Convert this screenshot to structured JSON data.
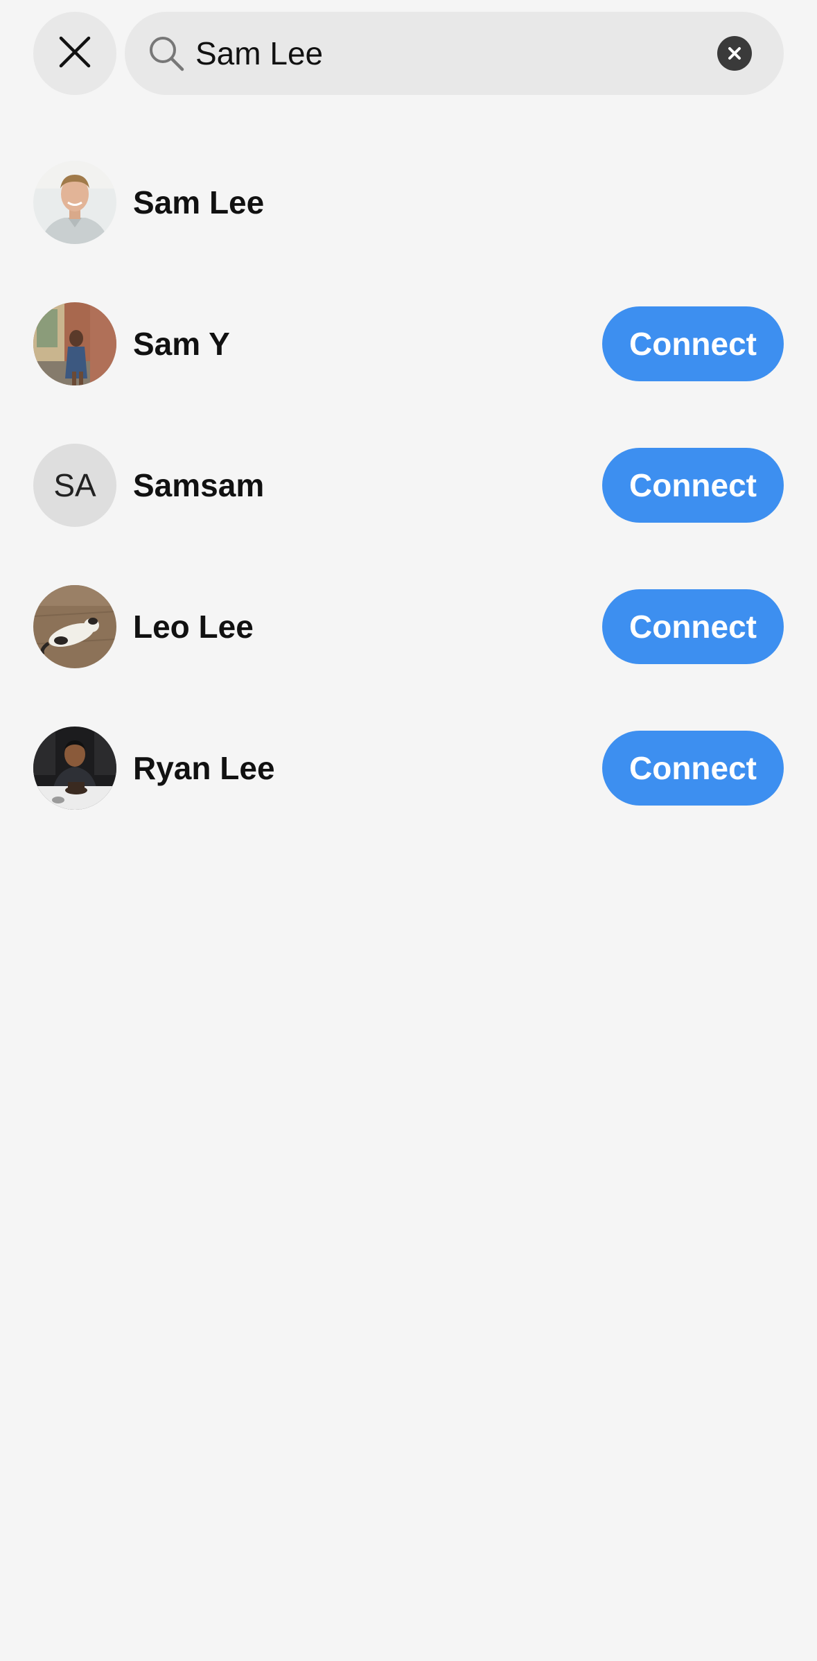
{
  "search": {
    "value": "Sam Lee",
    "placeholder": ""
  },
  "icons": {
    "close": "close-icon",
    "search": "search-icon",
    "clear": "clear-icon"
  },
  "colors": {
    "background": "#f5f5f5",
    "pill": "#e8e8e8",
    "accent": "#3d8ff0"
  },
  "results": [
    {
      "name": "Sam Lee",
      "avatar": "photo",
      "action": null
    },
    {
      "name": "Sam Y",
      "avatar": "photo",
      "action": "Connect"
    },
    {
      "name": "Samsam",
      "avatar": "initials",
      "initials": "SA",
      "action": "Connect"
    },
    {
      "name": "Leo Lee",
      "avatar": "photo",
      "action": "Connect"
    },
    {
      "name": "Ryan Lee",
      "avatar": "photo",
      "action": "Connect"
    }
  ]
}
